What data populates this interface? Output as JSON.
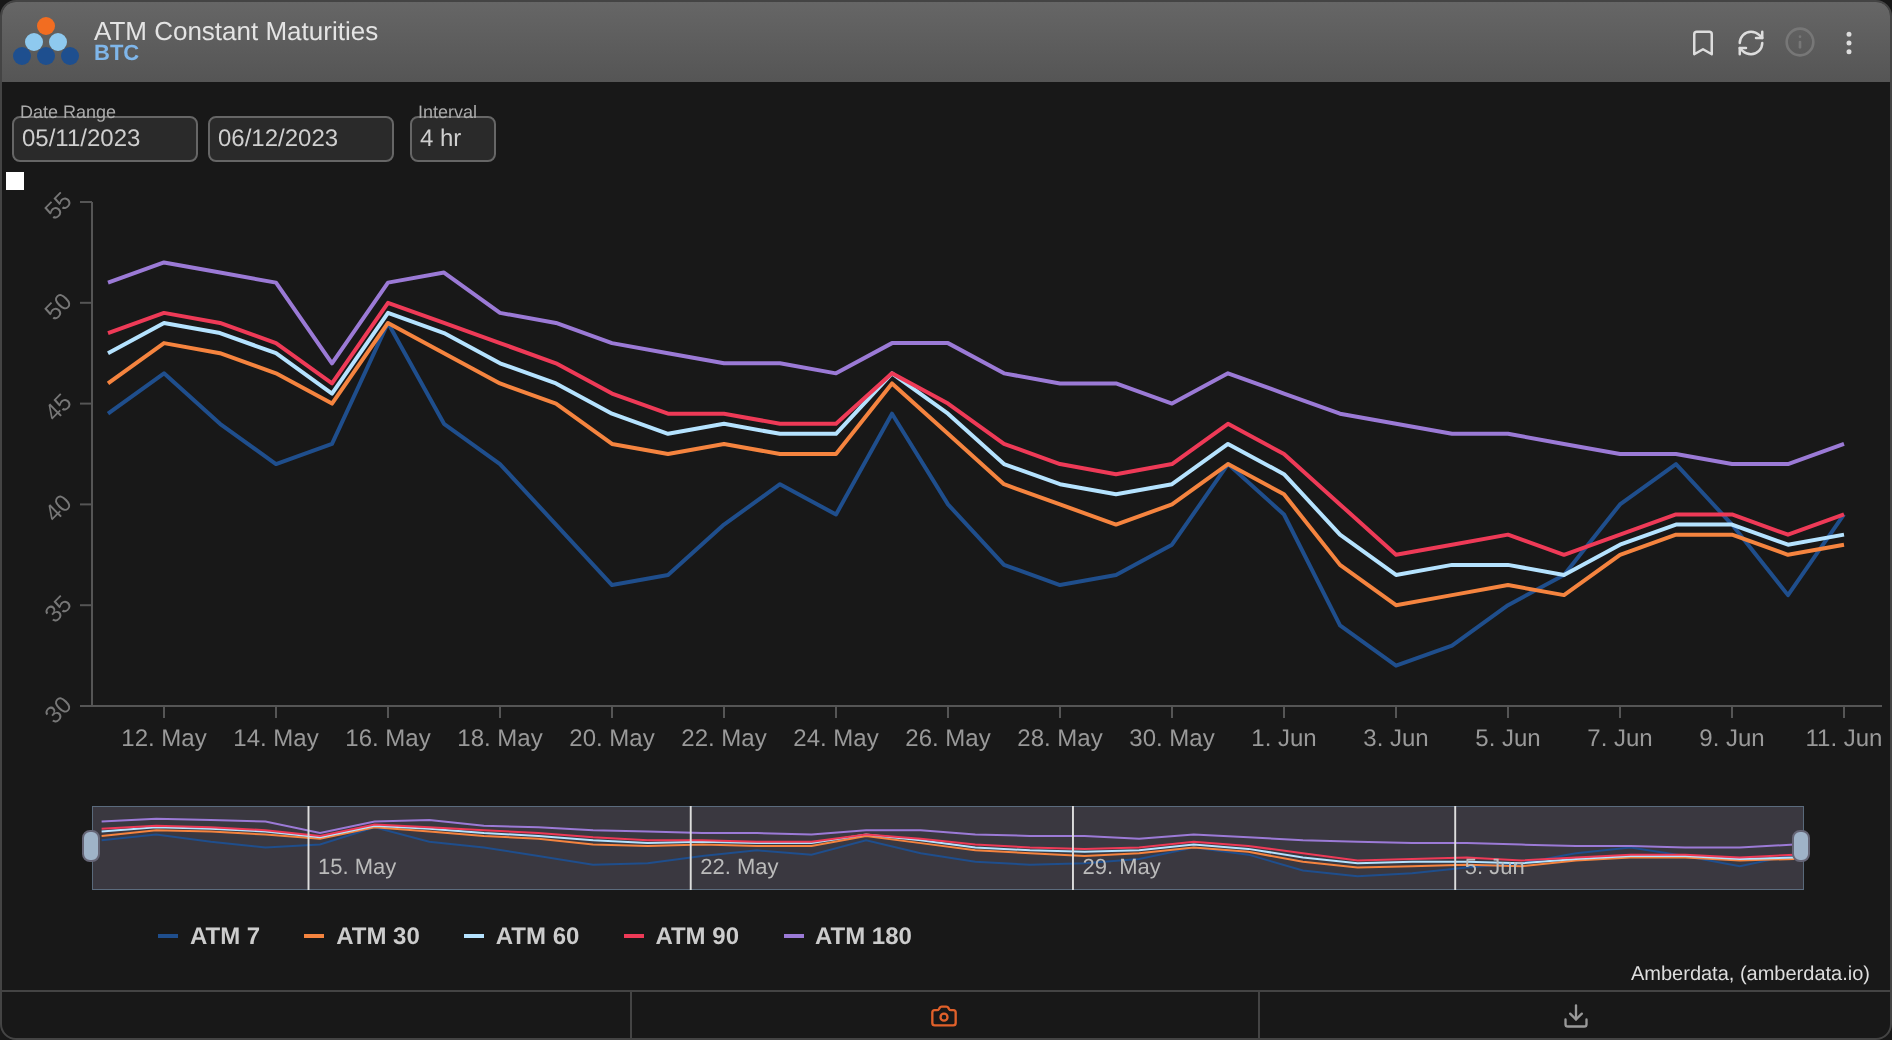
{
  "header": {
    "title": "ATM Constant Maturities",
    "subtitle": "BTC"
  },
  "controls": {
    "date_range_label": "Date Range",
    "start_date": "05/11/2023",
    "end_date": "06/12/2023",
    "interval_label": "Interval",
    "interval": "4 hr"
  },
  "chart_data": {
    "type": "line",
    "categories": [
      null,
      "12. May",
      null,
      "14. May",
      null,
      "16. May",
      null,
      "18. May",
      null,
      "20. May",
      null,
      "22. May",
      null,
      "24. May",
      null,
      "26. May",
      null,
      "28. May",
      null,
      "30. May",
      null,
      "1. Jun",
      null,
      "3. Jun",
      null,
      "5. Jun",
      null,
      "7. Jun",
      null,
      "9. Jun",
      null,
      "11. Jun"
    ],
    "ylim": [
      30,
      55
    ],
    "yticks": [
      30,
      35,
      40,
      45,
      50,
      55
    ],
    "series": [
      {
        "name": "ATM 7",
        "color": "#1f4e8c",
        "values": [
          44.5,
          46.5,
          44,
          42,
          43,
          49,
          44,
          42,
          39,
          36,
          36.5,
          39,
          41,
          39.5,
          44.5,
          40,
          37,
          36,
          36.5,
          38,
          42,
          39.5,
          34,
          32,
          33,
          35,
          36.5,
          40,
          42,
          39,
          35.5,
          39.5
        ]
      },
      {
        "name": "ATM 30",
        "color": "#f5843f",
        "values": [
          46,
          48,
          47.5,
          46.5,
          45,
          49,
          47.5,
          46,
          45,
          43,
          42.5,
          43,
          42.5,
          42.5,
          46,
          43.5,
          41,
          40,
          39,
          40,
          42,
          40.5,
          37,
          35,
          35.5,
          36,
          35.5,
          37.5,
          38.5,
          38.5,
          37.5,
          38
        ]
      },
      {
        "name": "ATM 60",
        "color": "#b5e3ff",
        "values": [
          47.5,
          49,
          48.5,
          47.5,
          45.5,
          49.5,
          48.5,
          47,
          46,
          44.5,
          43.5,
          44,
          43.5,
          43.5,
          46.5,
          44.5,
          42,
          41,
          40.5,
          41,
          43,
          41.5,
          38.5,
          36.5,
          37,
          37,
          36.5,
          38,
          39,
          39,
          38,
          38.5
        ]
      },
      {
        "name": "ATM 90",
        "color": "#ee3a57",
        "values": [
          48.5,
          49.5,
          49,
          48,
          46,
          50,
          49,
          48,
          47,
          45.5,
          44.5,
          44.5,
          44,
          44,
          46.5,
          45,
          43,
          42,
          41.5,
          42,
          44,
          42.5,
          40,
          37.5,
          38,
          38.5,
          37.5,
          38.5,
          39.5,
          39.5,
          38.5,
          39.5
        ]
      },
      {
        "name": "ATM 180",
        "color": "#9b7ad6",
        "values": [
          51,
          52,
          51.5,
          51,
          47,
          51,
          51.5,
          49.5,
          49,
          48,
          47.5,
          47,
          47,
          46.5,
          48,
          48,
          46.5,
          46,
          46,
          45,
          46.5,
          45.5,
          44.5,
          44,
          43.5,
          43.5,
          43,
          42.5,
          42.5,
          42,
          42,
          43
        ]
      }
    ]
  },
  "navigator": {
    "labels": [
      "15. May",
      "22. May",
      "29. May",
      "5. Jun"
    ]
  },
  "credit": "Amberdata, (amberdata.io)"
}
